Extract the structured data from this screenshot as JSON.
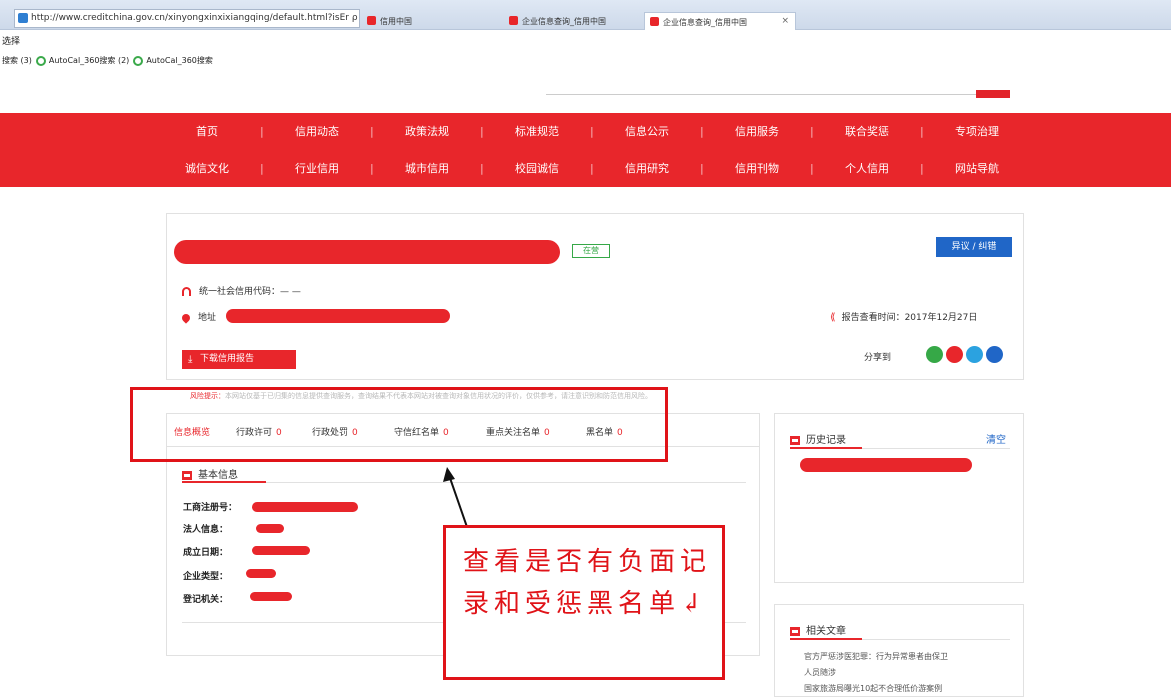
{
  "browser": {
    "address": "http://www.creditchina.gov.cn/xinyongxinxixiangqing/default.html?isEr ρ ▾ C",
    "tabs": [
      {
        "label": "信用中国"
      },
      {
        "label": "企业信息查询_信用中国"
      },
      {
        "label": "企业信息查询_信用中国",
        "close": "×"
      }
    ],
    "menu_line": "选择",
    "favorites": [
      "搜索 (3)",
      "AutoCal_360搜索 (2)",
      "AutoCal_360搜索"
    ]
  },
  "nav": {
    "row1": [
      "首页",
      "信用动态",
      "政策法规",
      "标准规范",
      "信息公示",
      "信用服务",
      "联合奖惩",
      "专项治理"
    ],
    "row2": [
      "诚信文化",
      "行业信用",
      "城市信用",
      "校园诚信",
      "信用研究",
      "信用刊物",
      "个人信用",
      "网站导航"
    ]
  },
  "company": {
    "status_badge": "在营",
    "dispute_button": "异议 / 纠错",
    "credit_code_label": "统一社会信用代码：— —",
    "address_label": "地址",
    "report_time": "报告查看时间：2017年12月27日",
    "download_button": "下载信用报告",
    "share_label": "分享到",
    "risk_title": "风险提示：",
    "risk_text": "本网站仅基于已归集的信息提供查询服务，查询结果不代表本网站对被查询对象信用状况的评价，仅供参考，请注意识别和防范信用风险。"
  },
  "tabs": [
    {
      "label": "信息概览",
      "count": ""
    },
    {
      "label": "行政许可",
      "count": "0"
    },
    {
      "label": "行政处罚",
      "count": "0"
    },
    {
      "label": "守信红名单",
      "count": "0"
    },
    {
      "label": "重点关注名单",
      "count": "0"
    },
    {
      "label": "黑名单",
      "count": "0"
    }
  ],
  "basic_info": {
    "title": "基本信息",
    "fields": [
      "工商注册号：",
      "法人信息：",
      "成立日期：",
      "企业类型：",
      "登记机关："
    ]
  },
  "history": {
    "title": "历史记录",
    "clear": "清空"
  },
  "related": {
    "title": "相关文章",
    "articles": [
      "官方严惩涉医犯罪：行为异常患者由保卫",
      "人员随涉",
      "国家旅游局曝光10起不合理低价游案例"
    ]
  },
  "annotation": {
    "callout": "查看是否有负面记录和受惩黑名单↲",
    "color": "#e01318"
  },
  "colors": {
    "brand_red": "#e8262b",
    "link_blue": "#2066c7",
    "ok_green": "#36a847"
  }
}
